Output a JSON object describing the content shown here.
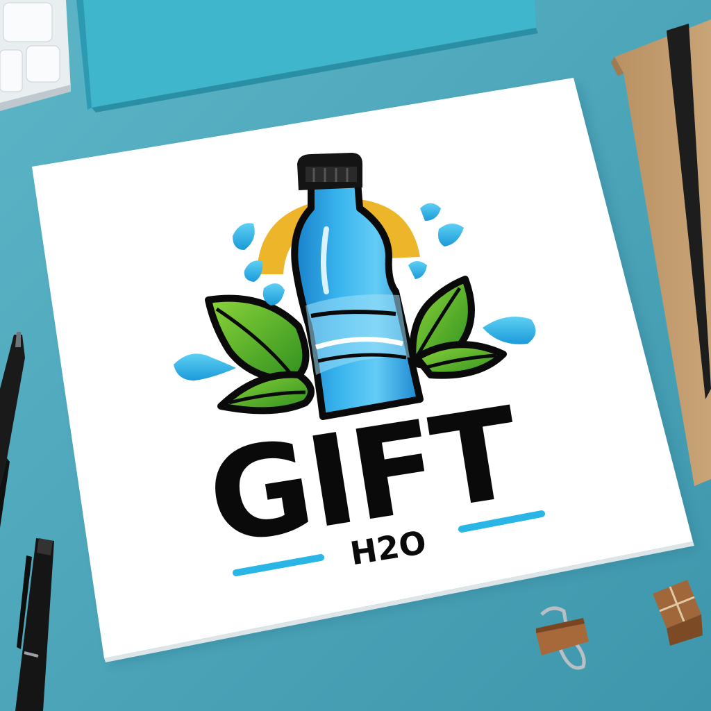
{
  "logo": {
    "wordmark": "GIFT",
    "subtitle": "H2O"
  },
  "colors": {
    "desk": "#4FA8BC",
    "paper": "#FFFFFF",
    "accent_blue": "#29B6E6",
    "leaf_green": "#4BB82E",
    "sun_yellow": "#EDB52A",
    "ink": "#0A0A0A"
  },
  "icons": [
    "water-bottle-icon",
    "leaf-icon",
    "water-drop-icon",
    "sun-icon",
    "keyboard",
    "pen",
    "binder-clip",
    "notebook"
  ]
}
